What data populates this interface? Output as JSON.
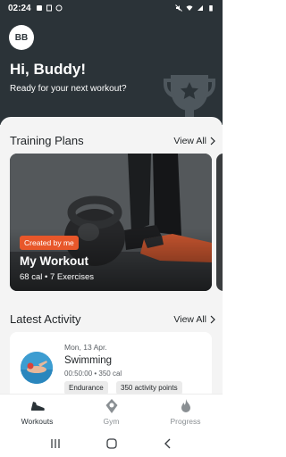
{
  "status_bar": {
    "time": "02:24"
  },
  "header": {
    "avatar_initials": "BB",
    "greeting": "Hi, Buddy!",
    "subtitle": "Ready for your next workout?"
  },
  "training_plans": {
    "title": "Training Plans",
    "view_all": "View All",
    "card": {
      "tag": "Created by me",
      "title": "My Workout",
      "meta": "68 cal • 7 Exercises"
    }
  },
  "latest_activity": {
    "title": "Latest Activity",
    "view_all": "View All",
    "item": {
      "date": "Mon, 13 Apr.",
      "name": "Swimming",
      "meta": "00:50:00 • 350 cal",
      "badges": [
        "Endurance",
        "350 activity points"
      ]
    }
  },
  "bottom_nav": {
    "items": [
      {
        "label": "Workouts",
        "icon": "shoe-icon",
        "active": true
      },
      {
        "label": "Gym",
        "icon": "location-pin-icon",
        "active": false
      },
      {
        "label": "Progress",
        "icon": "flame-icon",
        "active": false
      }
    ]
  },
  "system_nav": {
    "icons": [
      "recent-apps-icon",
      "home-icon",
      "back-icon"
    ]
  },
  "colors": {
    "header_bg": "#2b3338",
    "accent": "#e8572a",
    "sheet_bg": "#f4f4f4"
  }
}
